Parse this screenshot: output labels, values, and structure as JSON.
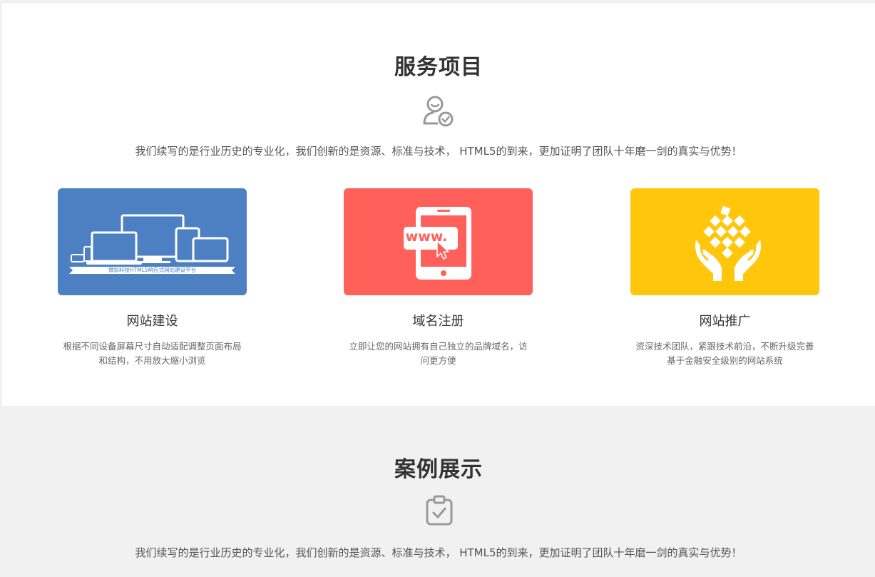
{
  "services": {
    "title": "服务项目",
    "icon": "user-check-icon",
    "description": "我们续写的是行业历史的专业化，我们创新的是资源、标准与技术， HTML5的到来，更加证明了团队十年磨一剑的真实与优势！",
    "cards": [
      {
        "title": "网站建设",
        "description": "根据不同设备屏幕尺寸自动适配调整页面布局和结构，不用放大缩小浏览",
        "banner_color": "#4c80c3",
        "banner_caption": "微加科技HTML5响应式网站建设平台",
        "icon": "responsive-devices-icon"
      },
      {
        "title": "域名注册",
        "description": "立即让您的网站拥有自己独立的品牌域名，访问更方便",
        "banner_color": "#ff615a",
        "banner_caption": "www.",
        "icon": "tablet-www-icon"
      },
      {
        "title": "网站推广",
        "description": "资深技术团队，紧跟技术前沿，不断升级完善基于金融安全级别的网站系统",
        "banner_color": "#ffc60b",
        "icon": "hands-cubes-icon"
      }
    ]
  },
  "cases": {
    "title": "案例展示",
    "icon": "clipboard-check-icon",
    "description": "我们续写的是行业历史的专业化，我们创新的是资源、标准与技术， HTML5的到来，更加证明了团队十年磨一剑的真实与优势！"
  }
}
